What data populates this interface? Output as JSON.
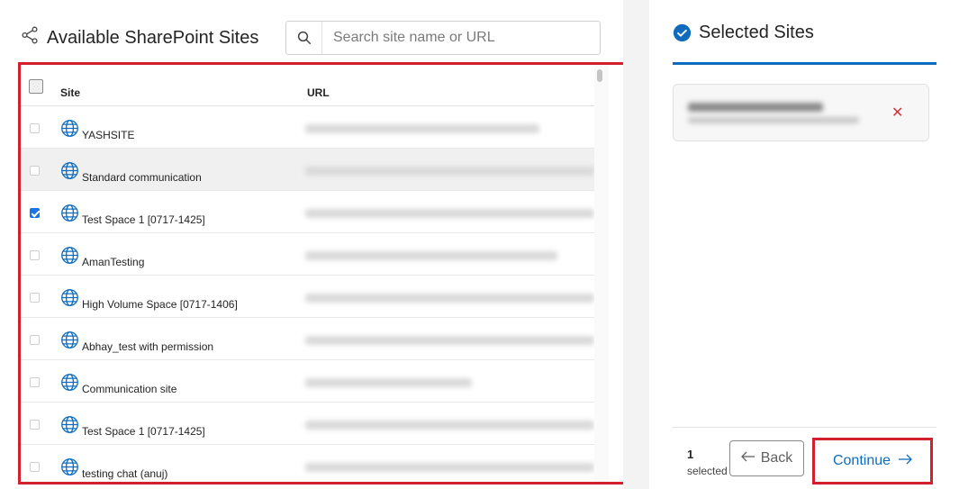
{
  "left_panel": {
    "title": "Available SharePoint Sites",
    "search": {
      "placeholder": "Search site name or URL",
      "value": ""
    }
  },
  "table": {
    "columns": {
      "site": "Site",
      "url": "URL"
    },
    "rows": [
      {
        "name": "YASHSITE",
        "checked": false,
        "url_hidden": true
      },
      {
        "name": "Standard communication",
        "checked": false,
        "url_hidden": true
      },
      {
        "name": "Test Space 1 [0717-1425]",
        "checked": true,
        "url_hidden": true
      },
      {
        "name": "AmanTesting",
        "checked": false,
        "url_hidden": true
      },
      {
        "name": "High Volume Space [0717-1406]",
        "checked": false,
        "url_hidden": true
      },
      {
        "name": "Abhay_test with permission",
        "checked": false,
        "url_hidden": true
      },
      {
        "name": "Communication site",
        "checked": false,
        "url_hidden": true
      },
      {
        "name": "Test Space 1 [0717-1425]",
        "checked": false,
        "url_hidden": true
      },
      {
        "name": "testing chat (anuj)",
        "checked": false,
        "url_hidden": true
      }
    ]
  },
  "right_panel": {
    "title": "Selected Sites",
    "selected_count": "1",
    "selected_label": "selected",
    "remove_symbol": "✕",
    "back_label": "Back",
    "continue_label": "Continue"
  },
  "colors": {
    "accent": "#0f6cbd",
    "highlight_border": "#d3202f",
    "checkbox": "#1a73e8"
  }
}
